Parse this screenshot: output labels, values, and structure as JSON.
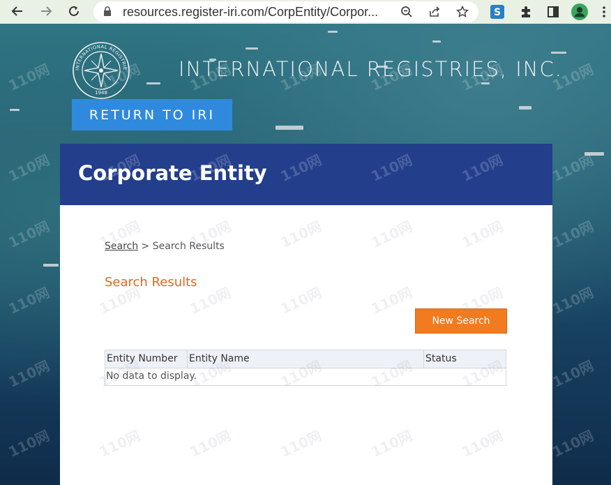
{
  "browser": {
    "url": "resources.register-iri.com/CorpEntity/Corpor...",
    "icons": [
      "back-arrow-icon",
      "forward-arrow-icon",
      "reload-icon",
      "lock-icon",
      "zoom-icon",
      "share-icon",
      "bookmark-star-icon",
      "extension-s-icon",
      "extensions-puzzle-icon",
      "side-panel-icon",
      "profile-icon",
      "menu-icon"
    ]
  },
  "header": {
    "site_title": "INTERNATIONAL REGISTRIES, INC.",
    "logo_text": "INTERNATIONAL REGISTRIES",
    "logo_year": "1948",
    "return_button": "RETURN TO IRI"
  },
  "card": {
    "title": "Corporate Entity",
    "breadcrumb": {
      "link": "Search",
      "separator": " > ",
      "current": "Search Results"
    },
    "results_title": "Search Results",
    "new_search_button": "New Search",
    "grid": {
      "columns": [
        "Entity Number",
        "Entity Name",
        "Status"
      ],
      "empty_text": "No data to display."
    }
  },
  "watermark": "110网",
  "colors": {
    "card_header": "#233e8b",
    "return_button": "#2f8ade",
    "accent_orange": "#f27b1f",
    "results_title": "#e2651f"
  }
}
